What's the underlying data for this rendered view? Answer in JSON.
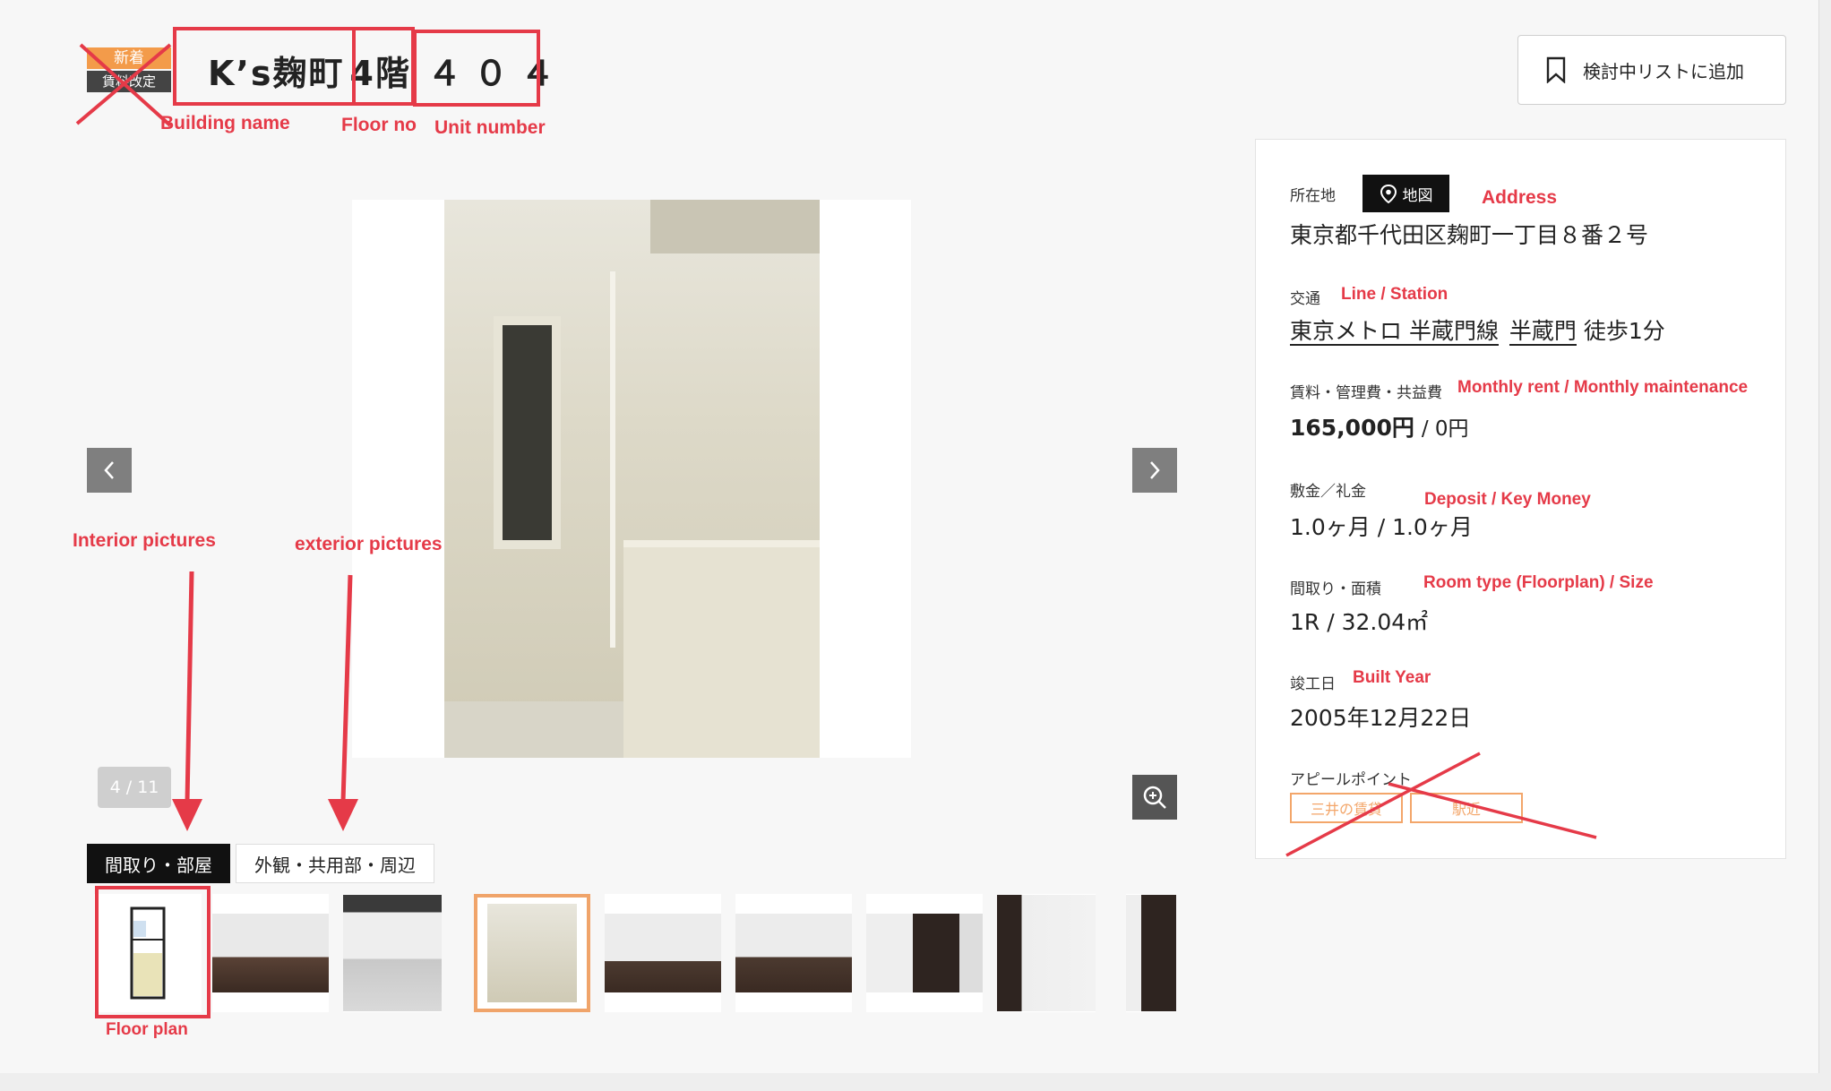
{
  "header": {
    "badge_new": "新着",
    "badge_revised": "賃料改定",
    "building_name": "K’s麹町",
    "floor": "4階",
    "unit": "４０４",
    "add_to_list": "検討中リストに追加"
  },
  "annotations": {
    "building_name": "Building name",
    "floor_no": "Floor no",
    "unit_number": "Unit number",
    "address": "Address",
    "line_station": "Line / Station",
    "rent": "Monthly rent / Monthly maintenance",
    "deposit": "Deposit /  Key Money",
    "room_type": "Room type (Floorplan) / Size",
    "built_year": "Built Year",
    "interior": "Interior pictures",
    "exterior": "exterior pictures",
    "floor_plan": "Floor plan"
  },
  "gallery": {
    "counter": "4 / 11",
    "tabs": [
      "間取り・部屋",
      "外観・共用部・周辺"
    ],
    "active_tab": 0,
    "selected_thumb": 3
  },
  "details": {
    "address_label": "所在地",
    "map_button": "地図",
    "address_value": "東京都千代田区麹町一丁目８番２号",
    "transport_label": "交通",
    "line": "東京メトロ 半蔵門線",
    "station": "半蔵門",
    "walk": "徒歩1分",
    "rent_label": "賃料・管理費・共益費",
    "rent_value": "165,000円",
    "maintenance_value": "/ 0円",
    "deposit_label": "敷金／礼金",
    "deposit_value": "1.0ヶ月 / 1.0ヶ月",
    "layout_label": "間取り・面積",
    "layout_value": "1R / 32.04㎡",
    "built_label": "竣工日",
    "built_value": "2005年12月22日",
    "appeal_label": "アピールポイント",
    "appeal_tags": [
      "三井の賃貸",
      "駅近"
    ]
  },
  "colors": {
    "annotation_red": "#e53a48",
    "badge_orange": "#f39b4a",
    "selected_outline": "#f0a46a"
  }
}
